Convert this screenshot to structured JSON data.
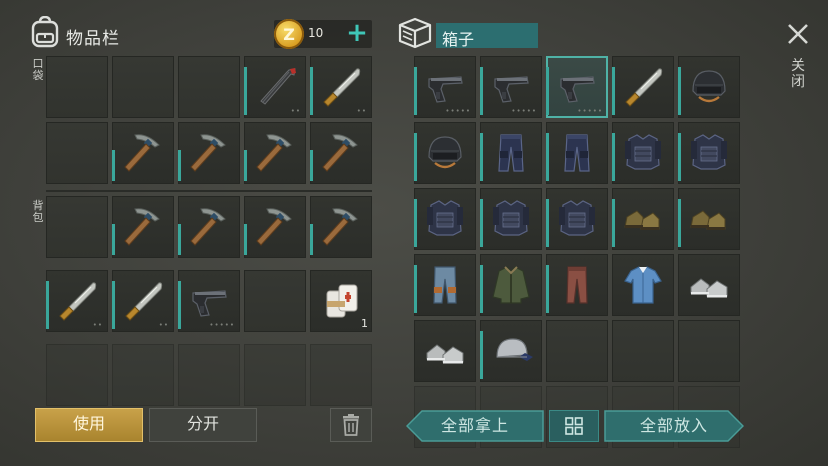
{
  "inventory": {
    "title": "物品栏",
    "label_pockets": "口袋",
    "label_backpack": "背包",
    "coins": "10",
    "coin_mark": "Z",
    "coin_add": "+",
    "slots": [
      {
        "icon": "empty"
      },
      {
        "icon": "empty"
      },
      {
        "icon": "empty"
      },
      {
        "icon": "crowbar",
        "durability": 0.85,
        "dots": "••"
      },
      {
        "icon": "machete",
        "durability": 0.85,
        "dots": "••"
      },
      {
        "icon": "empty"
      },
      {
        "icon": "pickaxe",
        "durability": 0.55
      },
      {
        "icon": "pickaxe",
        "durability": 0.55
      },
      {
        "icon": "pickaxe",
        "durability": 0.55
      },
      {
        "icon": "pickaxe",
        "durability": 0.55
      },
      {
        "icon": "empty"
      },
      {
        "icon": "pickaxe",
        "durability": 0.55
      },
      {
        "icon": "pickaxe",
        "durability": 0.55
      },
      {
        "icon": "pickaxe",
        "durability": 0.55
      },
      {
        "icon": "pickaxe",
        "durability": 0.55
      },
      {
        "icon": "machete",
        "durability": 0.85,
        "dots": "••"
      },
      {
        "icon": "machete",
        "durability": 0.85,
        "dots": "••"
      },
      {
        "icon": "pistol",
        "durability": 0.85,
        "dots": "•••••"
      },
      {
        "icon": "empty"
      },
      {
        "icon": "bandage",
        "qty": "1"
      },
      {
        "icon": "empty",
        "faded": true
      },
      {
        "icon": "empty",
        "faded": true
      },
      {
        "icon": "empty",
        "faded": true
      },
      {
        "icon": "empty",
        "faded": true
      },
      {
        "icon": "empty",
        "faded": true
      }
    ],
    "use_label": "使用",
    "split_label": "分开"
  },
  "box": {
    "title": "箱子",
    "slots": [
      {
        "icon": "pistol",
        "durability": 0.85,
        "dots": "•••••"
      },
      {
        "icon": "pistol",
        "durability": 0.85,
        "dots": "•••••"
      },
      {
        "icon": "pistol",
        "durability": 0.85,
        "dots": "•••••",
        "selected": true
      },
      {
        "icon": "machete",
        "durability": 0.85
      },
      {
        "icon": "helmet",
        "durability": 0.85
      },
      {
        "icon": "helmet",
        "durability": 0.85
      },
      {
        "icon": "pants-armor",
        "durability": 0.85
      },
      {
        "icon": "pants-armor",
        "durability": 0.85
      },
      {
        "icon": "vest",
        "durability": 0.85
      },
      {
        "icon": "vest",
        "durability": 0.85
      },
      {
        "icon": "vest",
        "durability": 0.85
      },
      {
        "icon": "vest",
        "durability": 0.85
      },
      {
        "icon": "vest",
        "durability": 0.85
      },
      {
        "icon": "boots",
        "durability": 0.85
      },
      {
        "icon": "boots",
        "durability": 0.85
      },
      {
        "icon": "jeans",
        "durability": 0.85
      },
      {
        "icon": "jacket",
        "durability": 0.85
      },
      {
        "icon": "pants",
        "durability": 0.85
      },
      {
        "icon": "shirt"
      },
      {
        "icon": "sneakers"
      },
      {
        "icon": "sneakers"
      },
      {
        "icon": "cap",
        "durability": 0.85
      },
      {
        "icon": "empty"
      },
      {
        "icon": "empty"
      },
      {
        "icon": "empty"
      },
      {
        "icon": "empty",
        "faded": true
      },
      {
        "icon": "empty",
        "faded": true
      },
      {
        "icon": "empty",
        "faded": true
      },
      {
        "icon": "empty",
        "faded": true
      },
      {
        "icon": "empty",
        "faded": true
      }
    ],
    "take_all_label": "全部拿上",
    "put_all_label": "全部放入"
  },
  "close_label": "关闭",
  "colors": {
    "accent": "#3aa79b",
    "gold": "#c9a24a",
    "teal_button": "#2f6e6d"
  }
}
